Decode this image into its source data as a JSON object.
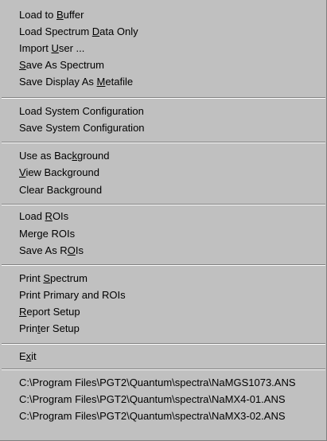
{
  "menu": {
    "groups": [
      {
        "items": [
          {
            "pre": "Load to ",
            "key": "B",
            "post": "uffer"
          },
          {
            "pre": "Load Spectrum ",
            "key": "D",
            "post": "ata Only"
          },
          {
            "pre": "Import ",
            "key": "U",
            "post": "ser ..."
          },
          {
            "pre": "",
            "key": "S",
            "post": "ave As Spectrum"
          },
          {
            "pre": "Save Display As ",
            "key": "M",
            "post": "etafile"
          }
        ]
      },
      {
        "items": [
          {
            "pre": "Load System Configuration",
            "key": "",
            "post": ""
          },
          {
            "pre": "Save System Configuration",
            "key": "",
            "post": ""
          }
        ]
      },
      {
        "items": [
          {
            "pre": "Use as Bac",
            "key": "k",
            "post": "ground"
          },
          {
            "pre": "",
            "key": "V",
            "post": "iew Background"
          },
          {
            "pre": "Clear Background",
            "key": "",
            "post": ""
          }
        ]
      },
      {
        "items": [
          {
            "pre": "Load ",
            "key": "R",
            "post": "OIs"
          },
          {
            "pre": "Merge ROIs",
            "key": "",
            "post": ""
          },
          {
            "pre": "Save As R",
            "key": "O",
            "post": "Is"
          }
        ]
      },
      {
        "items": [
          {
            "pre": "Print ",
            "key": "S",
            "post": "pectrum"
          },
          {
            "pre": "Print Primary and ROIs",
            "key": "",
            "post": ""
          },
          {
            "pre": "",
            "key": "R",
            "post": "eport Setup"
          },
          {
            "pre": "Prin",
            "key": "t",
            "post": "er Setup"
          }
        ]
      },
      {
        "items": [
          {
            "pre": "E",
            "key": "x",
            "post": "it"
          }
        ]
      },
      {
        "items": [
          {
            "pre": "C:\\Program Files\\PGT2\\Quantum\\spectra\\NaMGS1073.ANS",
            "key": "",
            "post": ""
          },
          {
            "pre": "C:\\Program Files\\PGT2\\Quantum\\spectra\\NaMX4-01.ANS",
            "key": "",
            "post": ""
          },
          {
            "pre": "C:\\Program Files\\PGT2\\Quantum\\spectra\\NaMX3-02.ANS",
            "key": "",
            "post": ""
          }
        ]
      }
    ]
  }
}
